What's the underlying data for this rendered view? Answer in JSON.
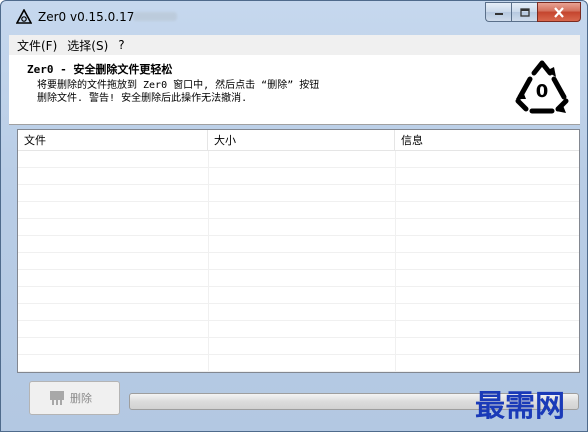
{
  "window": {
    "title": "Zer0 v0.15.0.17"
  },
  "menu": {
    "items": [
      "文件(F)",
      "选择(S)",
      "?"
    ]
  },
  "header": {
    "title": "Zer0 - 安全删除文件更轻松",
    "description_line1": "将要删除的文件拖放到 Zer0 窗口中, 然后点击 “删除” 按钮",
    "description_line2": "删除文件. 警告! 安全删除后此操作无法撤消.",
    "logo_digit": "0"
  },
  "file_list": {
    "columns": [
      "文件",
      "大小",
      "信息"
    ],
    "rows": []
  },
  "actions": {
    "delete_label": "删除"
  },
  "progress": {
    "value": 0
  },
  "watermark": {
    "text": "最需网"
  },
  "colors": {
    "watermark": "#1a3ab8",
    "close_button": "#c4452e",
    "titlebar": "#c6d8ee"
  }
}
